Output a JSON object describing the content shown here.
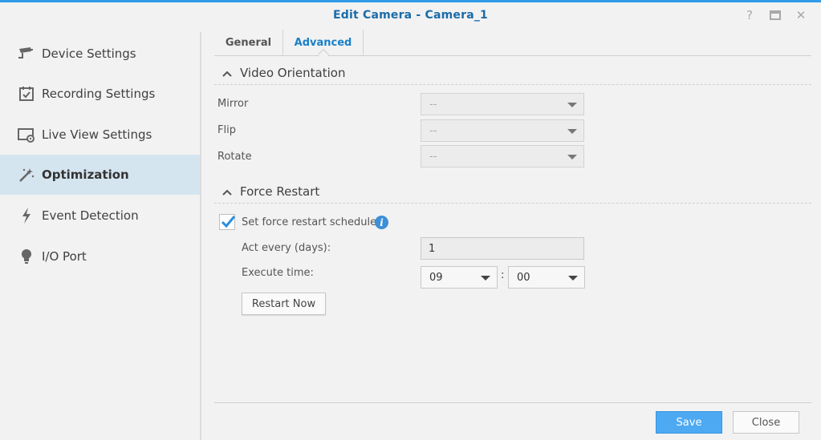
{
  "window": {
    "title": "Edit Camera - Camera_1",
    "controls": {
      "help": "?",
      "maximize": "□",
      "close": "✕"
    },
    "accent_color": "#2f9be9"
  },
  "sidebar": {
    "items": [
      {
        "label": "Device Settings",
        "icon": "camera-icon",
        "active": false
      },
      {
        "label": "Recording Settings",
        "icon": "calendar-check-icon",
        "active": false
      },
      {
        "label": "Live View Settings",
        "icon": "monitor-icon",
        "active": false
      },
      {
        "label": "Optimization",
        "icon": "magic-wand-icon",
        "active": true
      },
      {
        "label": "Event Detection",
        "icon": "lightning-icon",
        "active": false
      },
      {
        "label": "I/O Port",
        "icon": "lightbulb-icon",
        "active": false
      }
    ],
    "active_color": "#d5e5f0"
  },
  "tabs": [
    {
      "label": "General",
      "active": false
    },
    {
      "label": "Advanced",
      "active": true
    }
  ],
  "video_orientation": {
    "title": "Video Orientation",
    "fields": [
      {
        "label": "Mirror",
        "value": "--"
      },
      {
        "label": "Flip",
        "value": "--"
      },
      {
        "label": "Rotate",
        "value": "--"
      }
    ]
  },
  "force_restart": {
    "title": "Force Restart",
    "schedule_label": "Set force restart schedule",
    "schedule_checked": true,
    "info_icon": "i",
    "act_every_label": "Act every (days):",
    "act_every_value": "1",
    "execute_time_label": "Execute time:",
    "hour": "09",
    "minute": "00",
    "separator": ":",
    "restart_now_label": "Restart Now"
  },
  "footer": {
    "save_label": "Save",
    "close_label": "Close",
    "save_color": "#4da9f2"
  }
}
